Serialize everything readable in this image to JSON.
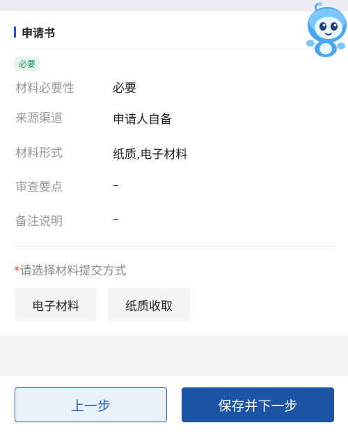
{
  "section": {
    "title": "申请书"
  },
  "tag": "必要",
  "details": [
    {
      "label": "材料必要性",
      "value": "必要"
    },
    {
      "label": "来源渠道",
      "value": "申请人自备"
    },
    {
      "label": "材料形式",
      "value": "纸质,电子材料"
    },
    {
      "label": "审查要点",
      "value": "–"
    },
    {
      "label": "备注说明",
      "value": "–"
    }
  ],
  "submit_prompt": {
    "required_mark": "*",
    "text": "请选择材料提交方式"
  },
  "options": [
    "电子材料",
    "纸质收取"
  ],
  "footer": {
    "prev_label": "上一步",
    "next_label": "保存并下一步"
  },
  "colors": {
    "accent": "#1f5fbf",
    "primary_button": "#1d54a6",
    "tag_green": "#1a9c5b",
    "required": "#e03c31"
  },
  "icons": {
    "mascot": "mascot-character-icon"
  }
}
